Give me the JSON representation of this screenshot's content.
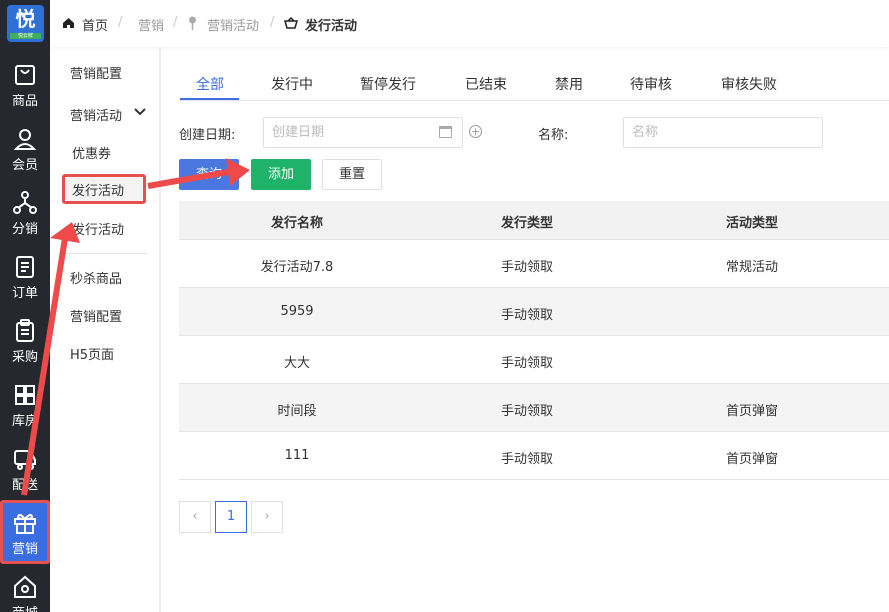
{
  "logo": {
    "glyph": "悦",
    "sub": "悦云鲜"
  },
  "rail": [
    {
      "label": "商品",
      "icon": "bag-icon"
    },
    {
      "label": "会员",
      "icon": "user-icon"
    },
    {
      "label": "分销",
      "icon": "network-icon"
    },
    {
      "label": "订单",
      "icon": "document-icon"
    },
    {
      "label": "采购",
      "icon": "clipboard-icon"
    },
    {
      "label": "库房",
      "icon": "grid-icon"
    },
    {
      "label": "配送",
      "icon": "truck-icon"
    },
    {
      "label": "营销",
      "icon": "gift-icon"
    },
    {
      "label": "商城",
      "icon": "home-icon"
    }
  ],
  "submenu": {
    "item1": "营销配置",
    "group": "营销活动",
    "sub1": "优惠券",
    "sub2": "发行活动",
    "sub3": "发行活动",
    "item2": "秒杀商品",
    "item3": "营销配置",
    "item4": "H5页面"
  },
  "breadcrumb": [
    "首页",
    "营销",
    "营销活动",
    "发行活动"
  ],
  "tabs": [
    "全部",
    "发行中",
    "暂停发行",
    "已结束",
    "禁用",
    "待审核",
    "审核失败"
  ],
  "filters": {
    "date_label": "创建日期:",
    "date_placeholder": "创建日期",
    "name_label": "名称:",
    "name_placeholder": "名称"
  },
  "buttons": {
    "query": "查询",
    "add": "添加",
    "reset": "重置"
  },
  "table": {
    "headers": [
      "发行名称",
      "发行类型",
      "活动类型"
    ],
    "rows": [
      [
        "发行活动7.8",
        "手动领取",
        "常规活动"
      ],
      [
        "5959",
        "手动领取",
        ""
      ],
      [
        "大大",
        "手动领取",
        ""
      ],
      [
        "时间段",
        "手动领取",
        "首页弹窗"
      ],
      [
        "111",
        "手动领取",
        "首页弹窗"
      ]
    ]
  },
  "pagination": {
    "prev": "‹",
    "current": "1",
    "next": "›"
  },
  "colors": {
    "accent": "#3a6ee0",
    "success": "#1fb36a",
    "highlight": "#e85050",
    "rail": "#26282f"
  }
}
